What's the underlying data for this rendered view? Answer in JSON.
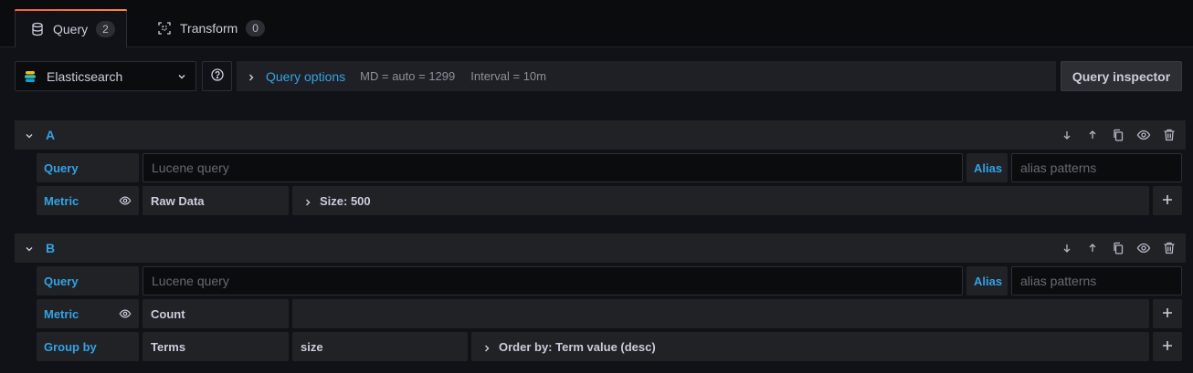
{
  "tabs": [
    {
      "label": "Query",
      "count": "2",
      "icon": "database-icon"
    },
    {
      "label": "Transform",
      "count": "0",
      "icon": "transform-icon"
    }
  ],
  "toolbar": {
    "datasource": "Elasticsearch",
    "query_options_label": "Query options",
    "md": "MD = auto = 1299",
    "interval": "Interval = 10m",
    "inspector_label": "Query inspector"
  },
  "queries": [
    {
      "refId": "A",
      "query_label": "Query",
      "query_placeholder": "Lucene query",
      "alias_label": "Alias",
      "alias_placeholder": "alias patterns",
      "metric_label": "Metric",
      "metric_value": "Raw Data",
      "metric_setting": "Size: 500"
    },
    {
      "refId": "B",
      "query_label": "Query",
      "query_placeholder": "Lucene query",
      "alias_label": "Alias",
      "alias_placeholder": "alias patterns",
      "metric_label": "Metric",
      "metric_value": "Count",
      "groupby_label": "Group by",
      "groupby_type": "Terms",
      "groupby_field": "size",
      "groupby_setting": "Order by: Term value (desc)"
    }
  ],
  "colors": {
    "accent": "#33a2e5",
    "tab_highlight": "#f55f3e",
    "background": "#111217"
  }
}
